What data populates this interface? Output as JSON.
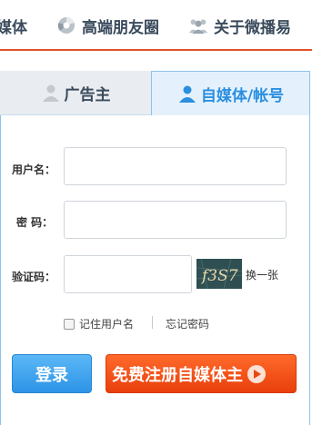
{
  "topnav": {
    "items": [
      {
        "label": "媒体",
        "icon": "none"
      },
      {
        "label": "高端朋友圈",
        "icon": "circle-segment-icon"
      },
      {
        "label": "关于微播易",
        "icon": "people-group-icon"
      }
    ]
  },
  "tabs": [
    {
      "label": "广告主",
      "icon": "person-icon",
      "active": false
    },
    {
      "label": "自媒体/帐号",
      "icon": "person-icon",
      "active": true
    }
  ],
  "form": {
    "username_label": "用户名：",
    "password_label": "密 码：",
    "captcha_label": "验证码：",
    "username_value": "",
    "password_value": "",
    "captcha_value": "",
    "captcha_image_text": "f3S7",
    "refresh_label": "换一张",
    "remember_label": "记住用户名",
    "forgot_label": "忘记密码",
    "login_button": "登录",
    "register_button": "免费注册自媒体主"
  },
  "colors": {
    "accent_blue": "#2a8fe0",
    "accent_orange": "#e83f0c",
    "nav_text": "#3a4a5c"
  }
}
